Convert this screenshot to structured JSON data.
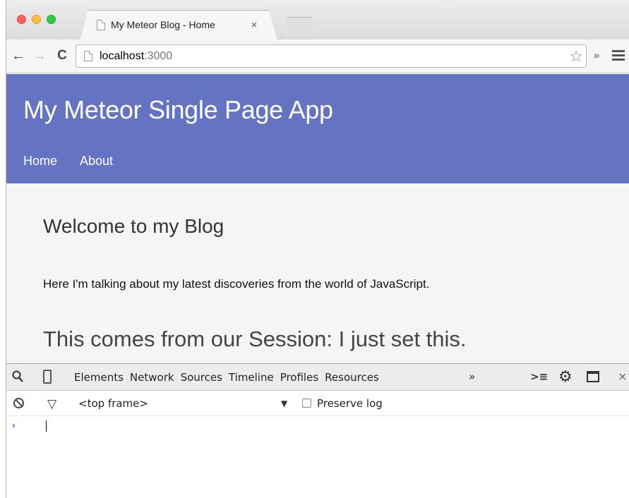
{
  "browser": {
    "tab_title": "My Meteor Blog - Home",
    "tab_close": "×",
    "url_host": "localhost",
    "url_rest": ":3000",
    "ext_chevron": "»"
  },
  "app": {
    "title": "My Meteor Single Page App",
    "nav": [
      {
        "label": "Home"
      },
      {
        "label": "About"
      }
    ],
    "welcome_heading": "Welcome to my Blog",
    "intro_text": "Here I'm talking about my latest discoveries from the world of JavaScript.",
    "session_text": "This comes from our Session: I just set this.",
    "header_color": "#6573c3"
  },
  "devtools": {
    "tabs": [
      {
        "label": "Elements"
      },
      {
        "label": "Network"
      },
      {
        "label": "Sources"
      },
      {
        "label": "Timeline"
      },
      {
        "label": "Profiles"
      },
      {
        "label": "Resources"
      }
    ],
    "more_tabs": "»",
    "close": "×",
    "frame_selector": "<top frame>",
    "frame_arrow": "▼",
    "preserve_log": "Preserve log",
    "prompt": "›"
  },
  "icons": {
    "back": "back-arrow-icon",
    "forward": "forward-arrow-icon",
    "reload": "reload-icon",
    "star": "bookmark-star-icon",
    "menu": "hamburger-menu-icon",
    "search": "search-icon",
    "device": "device-mode-icon",
    "console": "console-drawer-icon",
    "gear": "settings-gear-icon",
    "dock": "dock-side-icon",
    "clear": "clear-console-icon",
    "filter": "filter-icon"
  }
}
